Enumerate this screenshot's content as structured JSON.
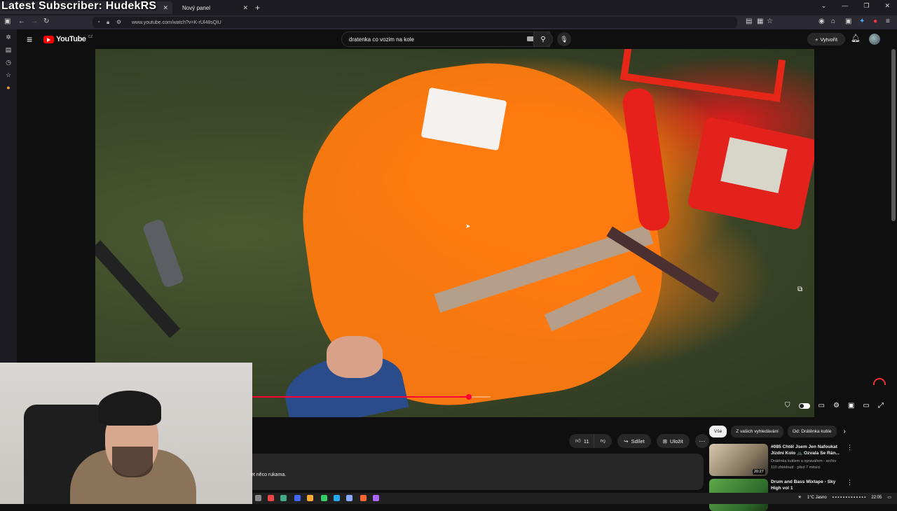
{
  "overlay": {
    "text": "Latest Subscriber: HudekRS"
  },
  "browser": {
    "tabs": [
      {
        "label": "",
        "active": true
      },
      {
        "label": "Nový panel",
        "active": false
      }
    ],
    "new_tab_icon": "plus-icon",
    "window_controls": [
      "chevron-down-icon",
      "minimize-icon",
      "restore-icon",
      "close-icon"
    ],
    "url": "www.youtube.com/watch?v=K-rUl48sQiU"
  },
  "youtube": {
    "logo_text": "YouTube",
    "logo_sup": "CZ",
    "search_value": "dratenka co vozim na kole",
    "create_label": "Vytvořit",
    "actions": {
      "likes": "11",
      "share_label": "Sdílet",
      "save_label": "Uložit"
    },
    "description_snippet": "et něco rukama.",
    "chips": [
      "Vše",
      "Z vašich vyhledávání",
      "Od: Drátěnka kutile"
    ],
    "recommendations": [
      {
        "title": "#085 Chtěl Jsem Jen Nafoukat Jízdní Kolo 🚲 Ozvala Se Rán...",
        "channel": "Drátěnka kutilem a opravářem - archiv",
        "meta": "110 zhlédnutí · před 7 měsíci",
        "duration": "20:27"
      },
      {
        "title": "Drum and Bass Mixtape - Sky High vol 1",
        "channel": "",
        "meta": "",
        "duration": ""
      }
    ],
    "video": {
      "progress_fraction": 0.91
    }
  },
  "taskbar": {
    "weather": "1°C  Jasno",
    "time": "22:05"
  },
  "colors": {
    "accent_red": "#ff0033",
    "bg": "#0f0f0f",
    "chip_active": "#f1f1f1"
  }
}
